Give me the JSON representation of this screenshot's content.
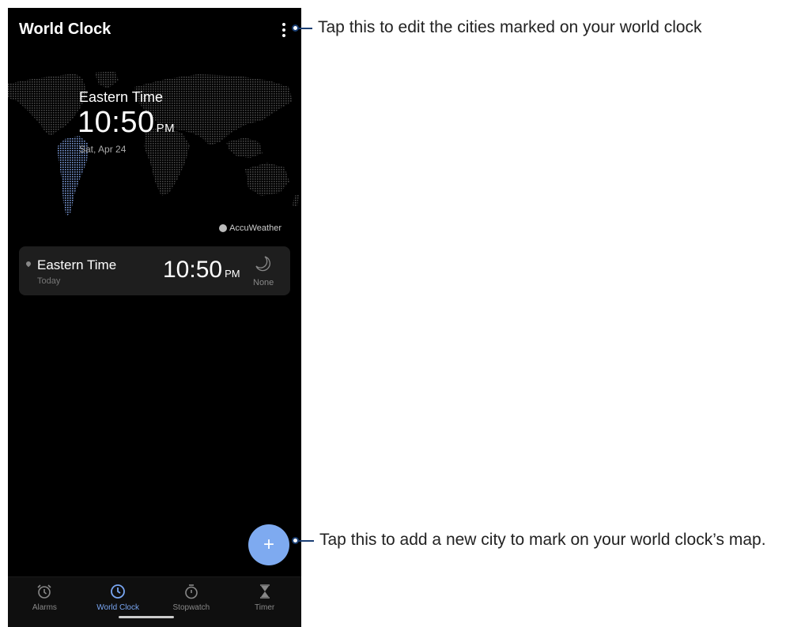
{
  "app_bar": {
    "title": "World Clock"
  },
  "map": {
    "city": "Eastern Time",
    "time": "10:50",
    "time_suffix": "PM",
    "date": "Sat, Apr 24",
    "provider": "AccuWeather"
  },
  "city_card": {
    "city": "Eastern Time",
    "day": "Today",
    "time": "10:50",
    "time_suffix": "PM",
    "weather": "None"
  },
  "fab": {
    "label": "+"
  },
  "bottom_nav": {
    "items": [
      {
        "label": "Alarms",
        "icon": "alarm-icon"
      },
      {
        "label": "World Clock",
        "icon": "clock-icon"
      },
      {
        "label": "Stopwatch",
        "icon": "stopwatch-icon"
      },
      {
        "label": "Timer",
        "icon": "hourglass-icon"
      }
    ],
    "active": "World Clock"
  },
  "callouts": {
    "menu": "Tap this to edit the cities marked on your world clock",
    "add": "Tap this to add a new city to mark on your world clock’s map."
  },
  "colors": {
    "accent": "#79a6f2",
    "fab": "#7eaaf0",
    "callout": "#1a3e73"
  }
}
